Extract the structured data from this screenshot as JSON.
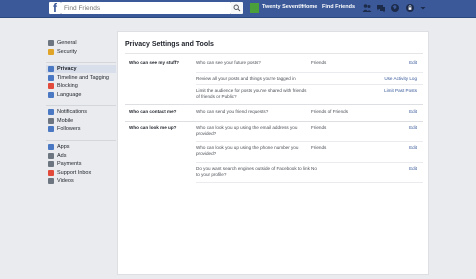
{
  "topbar": {
    "logo": "f",
    "search_placeholder": "Find Friends",
    "user_name": "Twenty Seventh",
    "home": "Home",
    "find_friends": "Find Friends",
    "bg_color": "#3b5998"
  },
  "sidebar": {
    "groups": [
      [
        {
          "label": "General",
          "icon": "gear-icon",
          "color": "#6d7581"
        },
        {
          "label": "Security",
          "icon": "shield-icon",
          "color": "#e0a428"
        }
      ],
      [
        {
          "label": "Privacy",
          "icon": "lock-icon",
          "color": "#4a78c2",
          "active": true
        },
        {
          "label": "Timeline and Tagging",
          "icon": "timeline-icon",
          "color": "#4a78c2"
        },
        {
          "label": "Blocking",
          "icon": "block-icon",
          "color": "#e24b3b"
        },
        {
          "label": "Language",
          "icon": "language-icon",
          "color": "#4a78c2"
        }
      ],
      [
        {
          "label": "Notifications",
          "icon": "globe-icon",
          "color": "#4a78c2"
        },
        {
          "label": "Mobile",
          "icon": "mobile-icon",
          "color": "#6d7581"
        },
        {
          "label": "Followers",
          "icon": "followers-icon",
          "color": "#4a78c2"
        }
      ],
      [
        {
          "label": "Apps",
          "icon": "apps-icon",
          "color": "#4a78c2"
        },
        {
          "label": "Ads",
          "icon": "ads-icon",
          "color": "#6d7581"
        },
        {
          "label": "Payments",
          "icon": "payments-icon",
          "color": "#6d7581"
        },
        {
          "label": "Support Inbox",
          "icon": "support-icon",
          "color": "#e24b3b"
        },
        {
          "label": "Videos",
          "icon": "videos-icon",
          "color": "#6d7581"
        }
      ]
    ]
  },
  "main": {
    "title": "Privacy Settings and Tools",
    "sections": [
      {
        "label": "Who can see my stuff?",
        "rows": [
          {
            "question": "Who can see your future posts?",
            "value": "Friends",
            "action": "Edit"
          },
          {
            "question": "Review all your posts and things you're tagged in",
            "value": "",
            "action": "Use Activity Log"
          },
          {
            "question": "Limit the audience for posts you've shared with friends of friends or Public?",
            "value": "",
            "action": "Limit Past Posts"
          }
        ]
      },
      {
        "label": "Who can contact me?",
        "rows": [
          {
            "question": "Who can send you friend requests?",
            "value": "Friends of Friends",
            "action": "Edit"
          }
        ]
      },
      {
        "label": "Who can look me up?",
        "rows": [
          {
            "question": "Who can look you up using the email address you provided?",
            "value": "Friends",
            "action": "Edit"
          },
          {
            "question": "Who can look you up using the phone number you provided?",
            "value": "Friends",
            "action": "Edit"
          },
          {
            "question": "Do you want search engines outside of Facebook to link to your profile?",
            "value": "No",
            "action": "Edit"
          }
        ]
      }
    ]
  }
}
